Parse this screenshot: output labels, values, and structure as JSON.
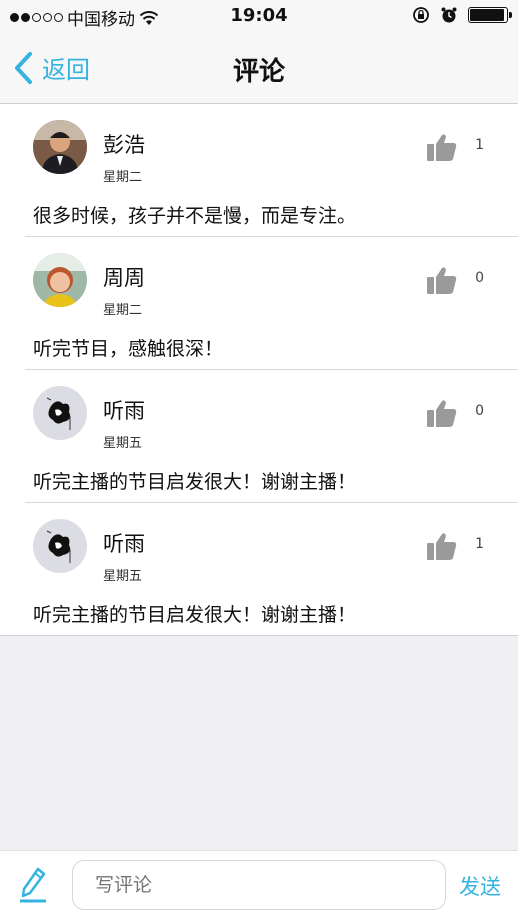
{
  "status_bar": {
    "carrier": "中国移动",
    "time": "19:04"
  },
  "nav": {
    "back_label": "返回",
    "title": "评论"
  },
  "comments": [
    {
      "name": "彭浩",
      "date": "星期二",
      "likes": "1",
      "text": "很多时候，孩子并不是慢，而是专注。"
    },
    {
      "name": "周周",
      "date": "星期二",
      "likes": "0",
      "text": "听完节目，感触很深！"
    },
    {
      "name": "听雨",
      "date": "星期五",
      "likes": "0",
      "text": "听完主播的节目启发很大！谢谢主播！"
    },
    {
      "name": "听雨",
      "date": "星期五",
      "likes": "1",
      "text": "听完主播的节目启发很大！谢谢主播！"
    }
  ],
  "composer": {
    "placeholder": "写评论",
    "send_label": "发送"
  },
  "colors": {
    "accent": "#35b3e0",
    "like_icon": "#9a9a9a"
  }
}
